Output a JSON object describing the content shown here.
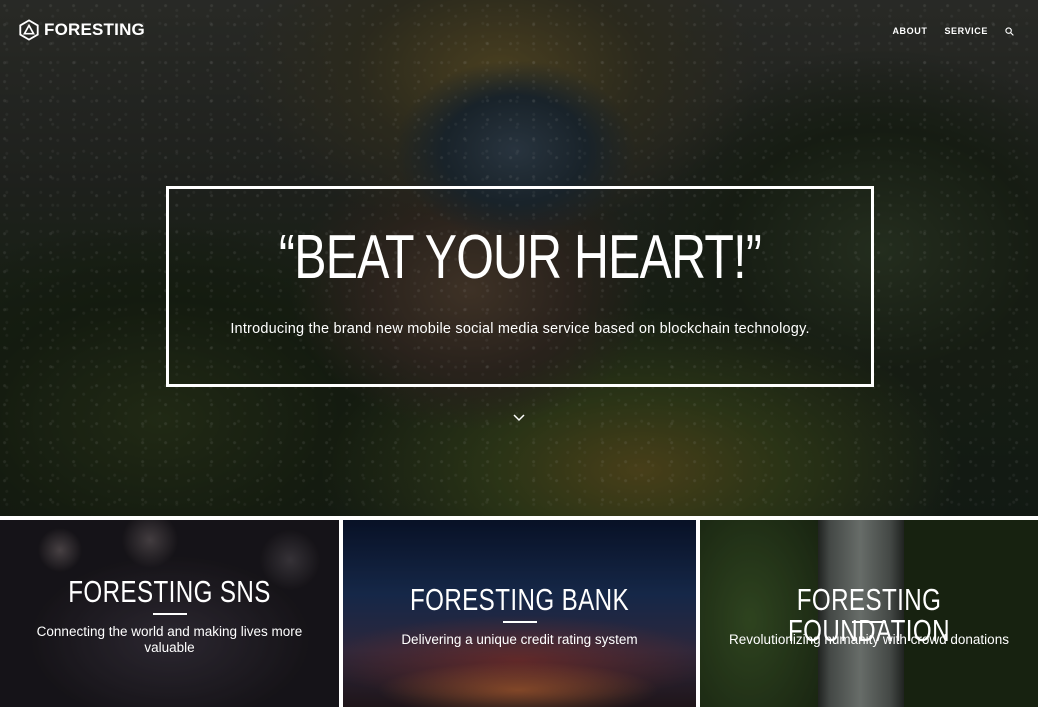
{
  "header": {
    "brand": "FORESTING",
    "nav": [
      {
        "label": "ABOUT"
      },
      {
        "label": "SERVICE"
      }
    ],
    "search_icon": "search-icon",
    "logo_icon": "hexagon-triangle-logo"
  },
  "hero": {
    "title": "“BEAT YOUR HEART!”",
    "subtitle": "Introducing the brand new mobile social media service based on blockchain technology.",
    "scroll_icon": "chevron-down-icon"
  },
  "cards": [
    {
      "title": "FORESTING SNS",
      "description": "Connecting the world and making lives more valuable"
    },
    {
      "title": "FORESTING BANK",
      "description": "Delivering a unique credit rating system"
    },
    {
      "title": "FORESTING FOUNDATION",
      "description": "Revolutionizing humanity with crowd donations"
    }
  ],
  "colors": {
    "text": "#ffffff",
    "separator": "#ffffff"
  }
}
